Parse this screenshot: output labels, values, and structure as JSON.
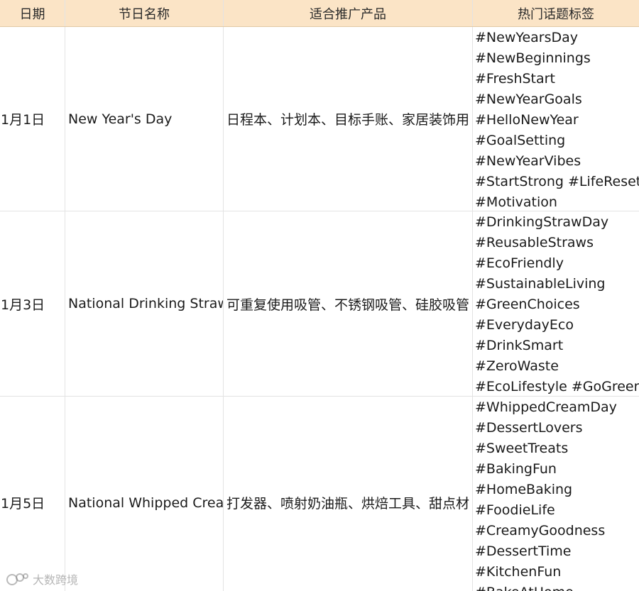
{
  "table": {
    "headers": {
      "date": "日期",
      "name": "节日名称",
      "products": "适合推广产品",
      "tags": "热门话题标签"
    },
    "rows": [
      {
        "date": "1月1日",
        "name": "New Year's Day",
        "products": "日程本、计划本、目标手账、家居装饰用",
        "tags": [
          "#NewYearsDay",
          "#NewBeginnings",
          "#FreshStart",
          "#NewYearGoals",
          "#HelloNewYear",
          "#GoalSetting",
          "#NewYearVibes",
          "#StartStrong #LifeReset",
          "#Motivation"
        ]
      },
      {
        "date": "1月3日",
        "name": "National Drinking Straw",
        "products": "可重复使用吸管、不锈钢吸管、硅胶吸管",
        "tags": [
          "#DrinkingStrawDay",
          "#ReusableStraws",
          "#EcoFriendly",
          "#SustainableLiving",
          "#GreenChoices",
          "#EverydayEco",
          "#DrinkSmart",
          "#ZeroWaste",
          "#EcoLifestyle #GoGreen"
        ]
      },
      {
        "date": "1月5日",
        "name": "National Whipped Cream",
        "products": "打发器、喷射奶油瓶、烘焙工具、甜点材",
        "tags": [
          "#WhippedCreamDay",
          "#DessertLovers",
          "#SweetTreats",
          "#BakingFun",
          "#HomeBaking",
          "#FoodieLife",
          "#CreamyGoodness",
          "#DessertTime",
          "#KitchenFun",
          "#BakeAtHome"
        ]
      }
    ]
  },
  "watermark": {
    "text": "大数跨境"
  }
}
